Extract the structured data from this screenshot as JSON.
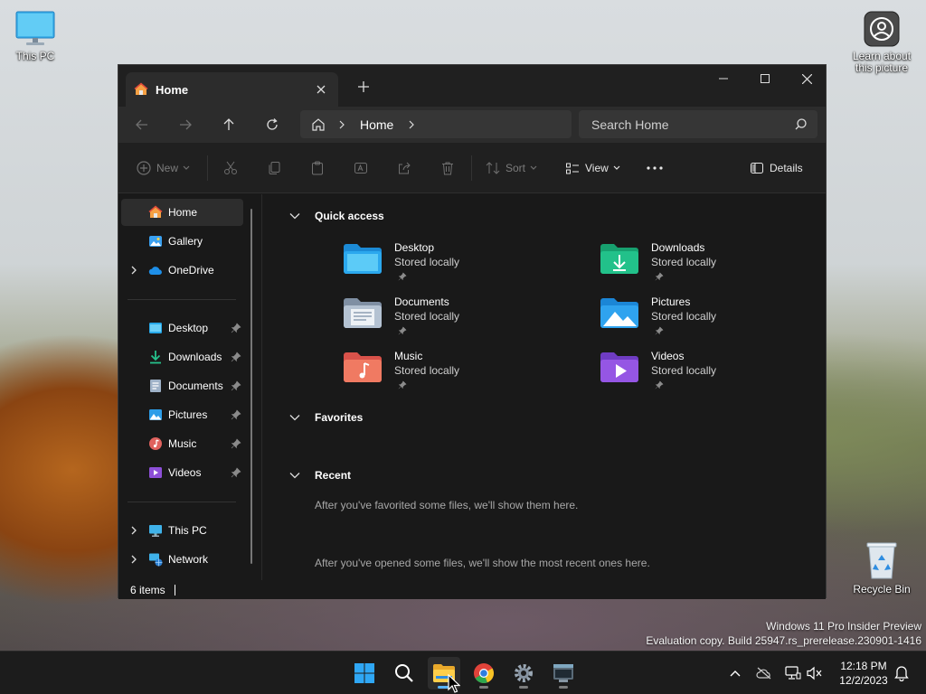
{
  "desktop": {
    "this_pc": "This PC",
    "learn": "Learn about this picture",
    "recycle_bin": "Recycle Bin"
  },
  "window": {
    "tab_title": "Home",
    "breadcrumb": "Home",
    "search_placeholder": "Search Home",
    "toolbar": {
      "new": "New",
      "sort": "Sort",
      "view": "View",
      "details": "Details"
    },
    "sidebar": {
      "home": "Home",
      "gallery": "Gallery",
      "onedrive": "OneDrive",
      "desktop": "Desktop",
      "downloads": "Downloads",
      "documents": "Documents",
      "pictures": "Pictures",
      "music": "Music",
      "videos": "Videos",
      "this_pc": "This PC",
      "network": "Network"
    },
    "quick_access": {
      "title": "Quick access",
      "items": [
        {
          "name": "Desktop",
          "sub": "Stored locally"
        },
        {
          "name": "Downloads",
          "sub": "Stored locally"
        },
        {
          "name": "Documents",
          "sub": "Stored locally"
        },
        {
          "name": "Pictures",
          "sub": "Stored locally"
        },
        {
          "name": "Music",
          "sub": "Stored locally"
        },
        {
          "name": "Videos",
          "sub": "Stored locally"
        }
      ]
    },
    "favorites": {
      "title": "Favorites",
      "note": "After you've favorited some files, we'll show them here."
    },
    "recent": {
      "title": "Recent",
      "note": "After you've opened some files, we'll show the most recent ones here."
    },
    "status": "6 items"
  },
  "watermark": {
    "line1": "Windows 11 Pro Insider Preview",
    "line2": "Evaluation copy. Build 25947.rs_prerelease.230901-1416"
  },
  "taskbar": {
    "time": "12:18 PM",
    "date": "12/2/2023"
  },
  "colors": {
    "window_bg": "#191919",
    "accent": "#59b4ff"
  }
}
